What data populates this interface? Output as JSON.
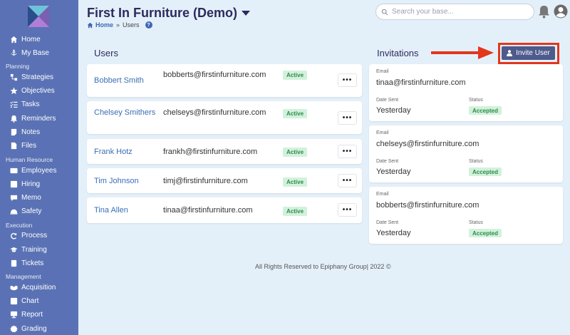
{
  "sidebar": {
    "items": [
      {
        "label": "Home",
        "icon": "home-icon"
      },
      {
        "label": "My Base",
        "icon": "anchor-icon"
      },
      {
        "label": "Strategies",
        "icon": "strategy-icon"
      },
      {
        "label": "Objectives",
        "icon": "star-icon"
      },
      {
        "label": "Tasks",
        "icon": "tasks-icon"
      },
      {
        "label": "Reminders",
        "icon": "bell-icon"
      },
      {
        "label": "Notes",
        "icon": "note-icon"
      },
      {
        "label": "Files",
        "icon": "file-icon"
      },
      {
        "label": "Employees",
        "icon": "id-card-icon"
      },
      {
        "label": "Hiring",
        "icon": "hiring-icon"
      },
      {
        "label": "Memo",
        "icon": "memo-icon"
      },
      {
        "label": "Safety",
        "icon": "safety-icon"
      },
      {
        "label": "Process",
        "icon": "redo-icon"
      },
      {
        "label": "Training",
        "icon": "graduation-cap-icon"
      },
      {
        "label": "Tickets",
        "icon": "ticket-icon"
      },
      {
        "label": "Acquisition",
        "icon": "handshake-icon"
      },
      {
        "label": "Chart",
        "icon": "chart-icon"
      },
      {
        "label": "Report",
        "icon": "report-icon"
      },
      {
        "label": "Grading",
        "icon": "grading-icon"
      }
    ],
    "sections": [
      "Planning",
      "Human Resource",
      "Execution",
      "Management"
    ]
  },
  "header": {
    "title": "First In Furniture (Demo)",
    "breadcrumb_home": "Home",
    "breadcrumb_sep": "»",
    "breadcrumb_current": "Users",
    "help": "?",
    "search_placeholder": "Search your base..."
  },
  "users": {
    "title": "Users",
    "rows": [
      {
        "name": "Bobbert Smith",
        "email": "bobberts@firstinfurniture.com",
        "status": "Active",
        "more": "•••"
      },
      {
        "name": "Chelsey Smithers",
        "email": "chelseys@firstinfurniture.com",
        "status": "Active",
        "more": "•••"
      },
      {
        "name": "Frank Hotz",
        "email": "frankh@firstinfurniture.com",
        "status": "Active",
        "more": "•••"
      },
      {
        "name": "Tim Johnson",
        "email": "timj@firstinfurniture.com",
        "status": "Active",
        "more": "•••"
      },
      {
        "name": "Tina Allen",
        "email": "tinaa@firstinfurniture.com",
        "status": "Active",
        "more": "•••"
      }
    ]
  },
  "invitations": {
    "title": "Invitations",
    "invite_button": "Invite User",
    "email_label": "Email",
    "date_label": "Date Sent",
    "status_label": "Status",
    "items": [
      {
        "email": "tinaa@firstinfurniture.com",
        "date": "Yesterday",
        "status": "Accepted"
      },
      {
        "email": "chelseys@firstinfurniture.com",
        "date": "Yesterday",
        "status": "Accepted"
      },
      {
        "email": "bobberts@firstinfurniture.com",
        "date": "Yesterday",
        "status": "Accepted"
      }
    ]
  },
  "footer": "All Rights Reserved to Epiphany Group| 2022 ©",
  "colors": {
    "sidebar": "#5a72b5",
    "background": "#e4f0f9",
    "title": "#2d2a5e",
    "link": "#3a6db5",
    "badge_bg": "#d2f1dc",
    "badge_text": "#2e8b4a",
    "invite_button": "#4d5a8c",
    "highlight": "#e3361c"
  }
}
